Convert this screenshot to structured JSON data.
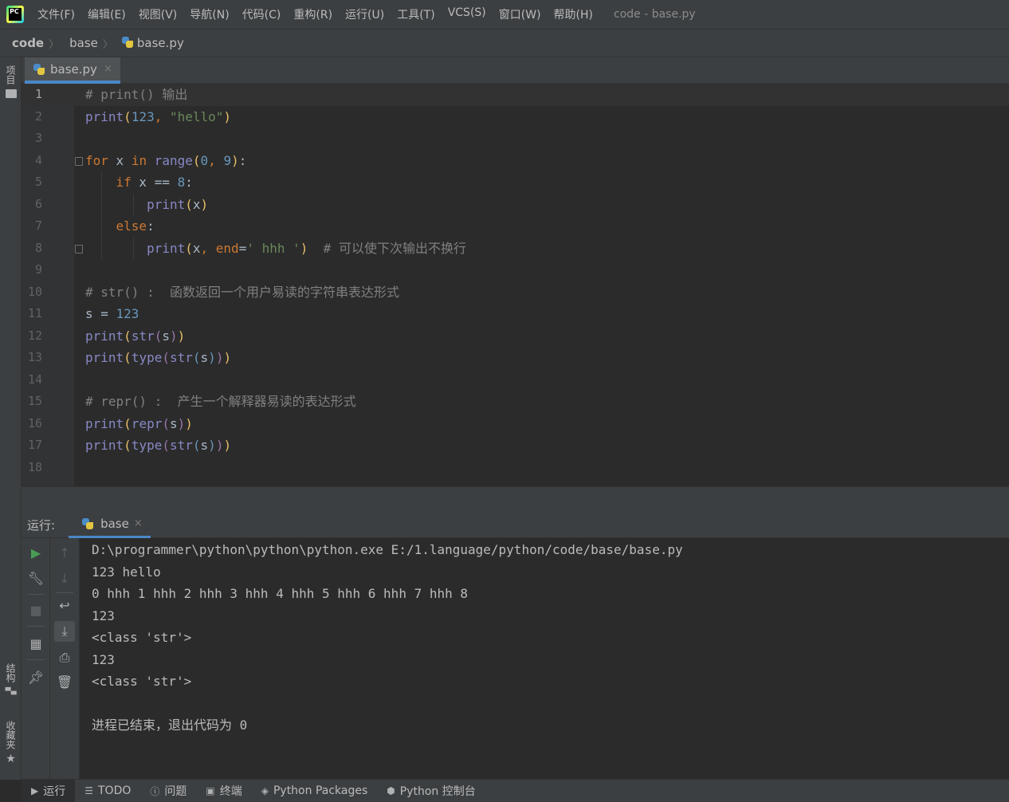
{
  "app": {
    "title": "code - base.py",
    "logo_text": "PC"
  },
  "menu": [
    "文件(F)",
    "编辑(E)",
    "视图(V)",
    "导航(N)",
    "代码(C)",
    "重构(R)",
    "运行(U)",
    "工具(T)",
    "VCS(S)",
    "窗口(W)",
    "帮助(H)"
  ],
  "breadcrumb": [
    "code",
    "base",
    "base.py"
  ],
  "left_strip": {
    "project": "项目",
    "structure": "结构",
    "favorites": "收藏夹"
  },
  "editor_tab": {
    "label": "base.py",
    "close": "×"
  },
  "code_lines": [
    {
      "num": "1",
      "tokens": [
        [
          "c",
          "# print() 输出"
        ]
      ]
    },
    {
      "num": "2",
      "tokens": [
        [
          "f",
          "print"
        ],
        [
          "pa",
          "("
        ],
        [
          "n",
          "123"
        ],
        [
          "k",
          ", "
        ],
        [
          "s",
          "\"hello\""
        ],
        [
          "pa",
          ")"
        ]
      ]
    },
    {
      "num": "3",
      "tokens": []
    },
    {
      "num": "4",
      "tokens": [
        [
          "k",
          "for"
        ],
        [
          "p",
          " x "
        ],
        [
          "k",
          "in"
        ],
        [
          "p",
          " "
        ],
        [
          "f",
          "range"
        ],
        [
          "pa",
          "("
        ],
        [
          "n",
          "0"
        ],
        [
          "k",
          ", "
        ],
        [
          "n",
          "9"
        ],
        [
          "pa",
          ")"
        ],
        [
          "p",
          ":"
        ]
      ]
    },
    {
      "num": "5",
      "tokens": [
        [
          "p",
          "    "
        ],
        [
          "k",
          "if"
        ],
        [
          "p",
          " x == "
        ],
        [
          "n",
          "8"
        ],
        [
          "p",
          ":"
        ]
      ]
    },
    {
      "num": "6",
      "tokens": [
        [
          "p",
          "        "
        ],
        [
          "f",
          "print"
        ],
        [
          "pa",
          "("
        ],
        [
          "p",
          "x"
        ],
        [
          "pa",
          ")"
        ]
      ]
    },
    {
      "num": "7",
      "tokens": [
        [
          "p",
          "    "
        ],
        [
          "k",
          "else"
        ],
        [
          "p",
          ":"
        ]
      ]
    },
    {
      "num": "8",
      "tokens": [
        [
          "p",
          "        "
        ],
        [
          "f",
          "print"
        ],
        [
          "pa",
          "("
        ],
        [
          "p",
          "x"
        ],
        [
          "k",
          ", "
        ],
        [
          "k2",
          "end"
        ],
        [
          "p",
          "="
        ],
        [
          "s",
          "' hhh '"
        ],
        [
          "pa",
          ")"
        ],
        [
          "p",
          "  "
        ],
        [
          "c",
          "# 可以使下次输出不换行"
        ]
      ]
    },
    {
      "num": "9",
      "tokens": []
    },
    {
      "num": "10",
      "tokens": [
        [
          "c",
          "# str() :  函数返回一个用户易读的字符串表达形式"
        ]
      ]
    },
    {
      "num": "11",
      "tokens": [
        [
          "p",
          "s = "
        ],
        [
          "n",
          "123"
        ]
      ]
    },
    {
      "num": "12",
      "tokens": [
        [
          "f",
          "print"
        ],
        [
          "pa",
          "("
        ],
        [
          "f",
          "str"
        ],
        [
          "pb",
          "("
        ],
        [
          "p",
          "s"
        ],
        [
          "pb",
          ")"
        ],
        [
          "pa",
          ")"
        ]
      ]
    },
    {
      "num": "13",
      "tokens": [
        [
          "f",
          "print"
        ],
        [
          "pa",
          "("
        ],
        [
          "f",
          "type"
        ],
        [
          "pb",
          "("
        ],
        [
          "f",
          "str"
        ],
        [
          "pc",
          "("
        ],
        [
          "p",
          "s"
        ],
        [
          "pc",
          ")"
        ],
        [
          "pb",
          ")"
        ],
        [
          "pa",
          ")"
        ]
      ]
    },
    {
      "num": "14",
      "tokens": []
    },
    {
      "num": "15",
      "tokens": [
        [
          "c",
          "# repr() :  产生一个解释器易读的表达形式"
        ]
      ]
    },
    {
      "num": "16",
      "tokens": [
        [
          "f",
          "print"
        ],
        [
          "pa",
          "("
        ],
        [
          "f",
          "repr"
        ],
        [
          "pb",
          "("
        ],
        [
          "p",
          "s"
        ],
        [
          "pb",
          ")"
        ],
        [
          "pa",
          ")"
        ]
      ]
    },
    {
      "num": "17",
      "tokens": [
        [
          "f",
          "print"
        ],
        [
          "pa",
          "("
        ],
        [
          "f",
          "type"
        ],
        [
          "pb",
          "("
        ],
        [
          "f",
          "str"
        ],
        [
          "pc",
          "("
        ],
        [
          "p",
          "s"
        ],
        [
          "pc",
          ")"
        ],
        [
          "pb",
          ")"
        ],
        [
          "pa",
          ")"
        ]
      ]
    },
    {
      "num": "18",
      "tokens": []
    }
  ],
  "run_panel": {
    "label": "运行:",
    "tab": "base",
    "close": "×"
  },
  "console_lines": [
    "D:\\programmer\\python\\python\\python.exe E:/1.language/python/code/base/base.py",
    "123 hello",
    "0 hhh 1 hhh 2 hhh 3 hhh 4 hhh 5 hhh 6 hhh 7 hhh 8",
    "123",
    "<class 'str'>",
    "123",
    "<class 'str'>",
    "",
    "进程已结束，退出代码为 0"
  ],
  "bottom_tabs": [
    {
      "name": "run",
      "icon": "play-icon",
      "label": "运行"
    },
    {
      "name": "todo",
      "icon": "list-icon",
      "label": "TODO"
    },
    {
      "name": "problems",
      "icon": "info-icon",
      "label": "问题"
    },
    {
      "name": "terminal",
      "icon": "terminal-icon",
      "label": "终端"
    },
    {
      "name": "python-packages",
      "icon": "layers-icon",
      "label": "Python Packages"
    },
    {
      "name": "python-console",
      "icon": "python-icon",
      "label": "Python 控制台"
    }
  ],
  "colors": {
    "keyword": "#cc7832",
    "builtin": "#8888c6",
    "number": "#6897bb",
    "string": "#6a8759",
    "comment": "#808080",
    "accent": "#4a88c7"
  }
}
